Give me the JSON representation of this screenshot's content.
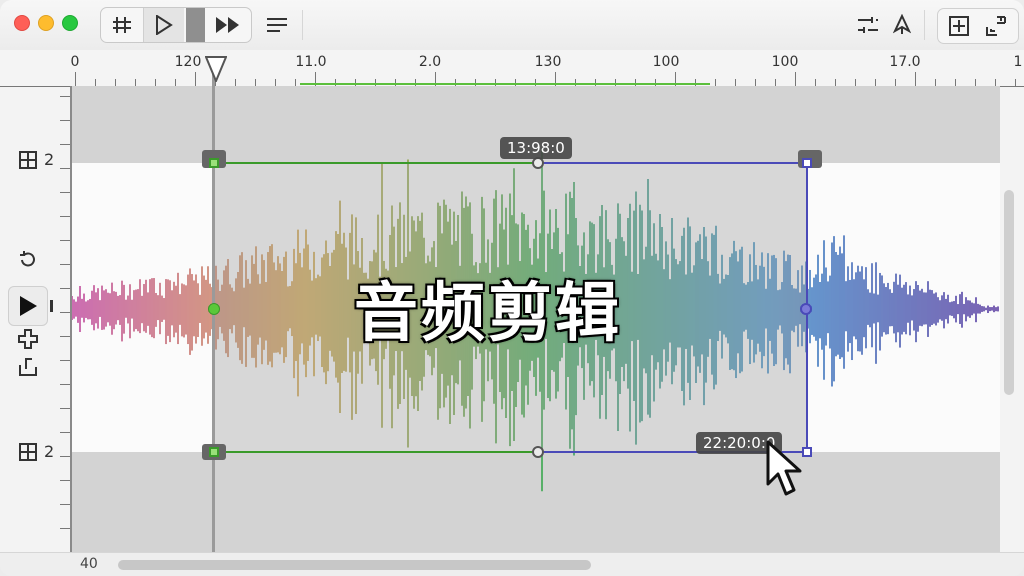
{
  "toolbar": {
    "buttons": [
      "trim-icon",
      "play-icon",
      "fast-forward-icon",
      "menu-icon",
      "adjust-icon",
      "pen-icon",
      "add-marker-icon",
      "crop-icon"
    ]
  },
  "ruler": {
    "labels": [
      "0",
      "120",
      "11.0",
      "2.0",
      "130",
      "100",
      "100",
      "17.0",
      "1"
    ]
  },
  "selection": {
    "start_time": "13:98:0",
    "end_time": "22:20:0:0"
  },
  "caption": "音频剪辑",
  "timeline": {
    "position_label": "40"
  },
  "sidebar": {
    "track_label_top": "2",
    "track_label_bottom": "2"
  },
  "colors": {
    "selection_left": "#3a9a2a",
    "selection_right": "#4a4ab8",
    "waveform": [
      "#c04aa0",
      "#d0a040",
      "#3aa84a",
      "#3a8ac8",
      "#5a3aa0"
    ]
  }
}
